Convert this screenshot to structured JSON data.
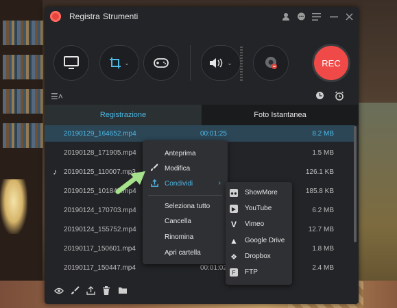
{
  "menubar": {
    "items": [
      "Registra",
      "Strumenti"
    ]
  },
  "toolbar": {
    "rec_label": "REC"
  },
  "tabs": [
    "Registrazione",
    "Foto Istantanea"
  ],
  "files": [
    {
      "name": "20190129_164652.mp4",
      "duration": "00:01:25",
      "size": "8.2 MB"
    },
    {
      "name": "20190128_171905.mp4",
      "duration": "",
      "size": "1.5 MB"
    },
    {
      "name": "20190125_110007.mp3",
      "duration": "",
      "size": "126.1 KB"
    },
    {
      "name": "20190125_101845.mp4",
      "duration": "",
      "size": "185.8 KB"
    },
    {
      "name": "20190124_170703.mp4",
      "duration": "",
      "size": "6.2 MB"
    },
    {
      "name": "20190124_155752.mp4",
      "duration": "",
      "size": "12.7 MB"
    },
    {
      "name": "20190117_150601.mp4",
      "duration": "",
      "size": "1.8 MB"
    },
    {
      "name": "20190117_150447.mp4",
      "duration": "00:01:02",
      "size": "2.4 MB"
    }
  ],
  "context_menu": {
    "items": [
      "Anteprima",
      "Modifica",
      "Condividi",
      "Seleziona tutto",
      "Cancella",
      "Rinomina",
      "Apri cartella"
    ]
  },
  "share_menu": {
    "items": [
      "ShowMore",
      "YouTube",
      "Vimeo",
      "Google Drive",
      "Dropbox",
      "FTP"
    ]
  },
  "colors": {
    "accent": "#4cb9e6",
    "rec": "#f04a48",
    "window": "#232427"
  }
}
